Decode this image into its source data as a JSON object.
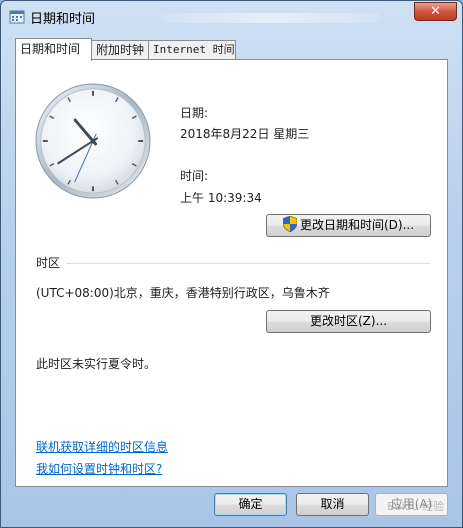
{
  "window": {
    "title": "日期和时间",
    "close_label": "✕"
  },
  "tabs": [
    {
      "label": "日期和时间"
    },
    {
      "label": "附加时钟"
    },
    {
      "label": "Internet 时间"
    }
  ],
  "datetime": {
    "date_label": "日期:",
    "date_value": "2018年8月22日 星期三",
    "time_label": "时间:",
    "time_value": "上午 10:39:34",
    "change_button": "更改日期和时间(D)..."
  },
  "clock": {
    "hour": 10,
    "minute": 39,
    "second": 34
  },
  "timezone": {
    "section_label": "时区",
    "value": "(UTC+08:00)北京，重庆，香港特别行政区，乌鲁木齐",
    "change_button": "更改时区(Z)...",
    "dst_note": "此时区未实行夏令时。"
  },
  "links": {
    "online_info": "联机获取详细的时区信息",
    "how_to": "我如何设置时钟和时区?"
  },
  "footer": {
    "ok": "确定",
    "cancel": "取消",
    "apply": "应用(A)"
  },
  "watermark": "Baidu 经验",
  "colors": {
    "link": "#0066cc",
    "accent": "#3c7fb1"
  }
}
